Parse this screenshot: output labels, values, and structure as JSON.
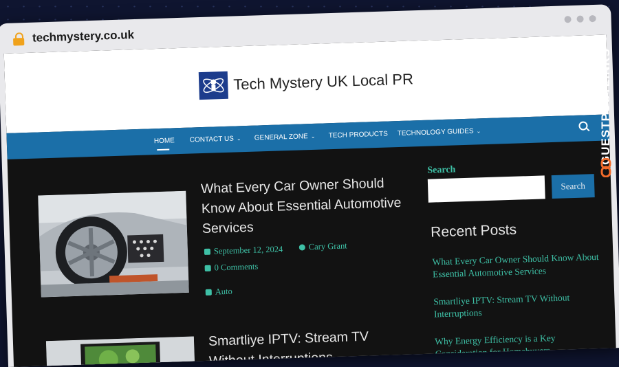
{
  "browser": {
    "url": "techmystery.co.uk"
  },
  "site": {
    "title": "Tech Mystery UK Local PR"
  },
  "nav": {
    "items": [
      {
        "label": "HOME",
        "has_dropdown": false,
        "active": true
      },
      {
        "label": "CONTACT US",
        "has_dropdown": true,
        "active": false
      },
      {
        "label": "GENERAL ZONE",
        "has_dropdown": true,
        "active": false
      },
      {
        "label": "TECH PRODUCTS",
        "has_dropdown": false,
        "active": false
      },
      {
        "label": "TECHNOLOGY GUIDES",
        "has_dropdown": true,
        "active": false
      }
    ]
  },
  "posts": [
    {
      "title": "What Every Car Owner Should Know About Essential Automotive Services",
      "date": "September 12, 2024",
      "author": "Cary Grant",
      "comments": "0 Comments",
      "category": "Auto"
    },
    {
      "title": "Smartliye IPTV: Stream TV Without Interruptions"
    }
  ],
  "sidebar": {
    "search_label": "Search",
    "search_button": "Search",
    "search_value": "",
    "recent_heading": "Recent Posts",
    "recent_posts": [
      "What Every Car Owner Should Know About Essential Automotive Services",
      "Smartliye IPTV: Stream TV Without Interruptions",
      "Why Energy Efficiency is a Key Consideration for Homebuyers"
    ]
  },
  "watermark": {
    "text_light": "GUEST",
    "text_bold": "POSTLINKS"
  },
  "colors": {
    "nav_bg": "#1b6fa8",
    "accent": "#3ec0a6",
    "page_bg": "#121212",
    "lock": "#f0a21b"
  },
  "icons": [
    "lock-icon",
    "search-icon",
    "calendar-icon",
    "user-icon",
    "comment-icon",
    "folder-icon",
    "chevron-down-icon",
    "link-icon"
  ]
}
